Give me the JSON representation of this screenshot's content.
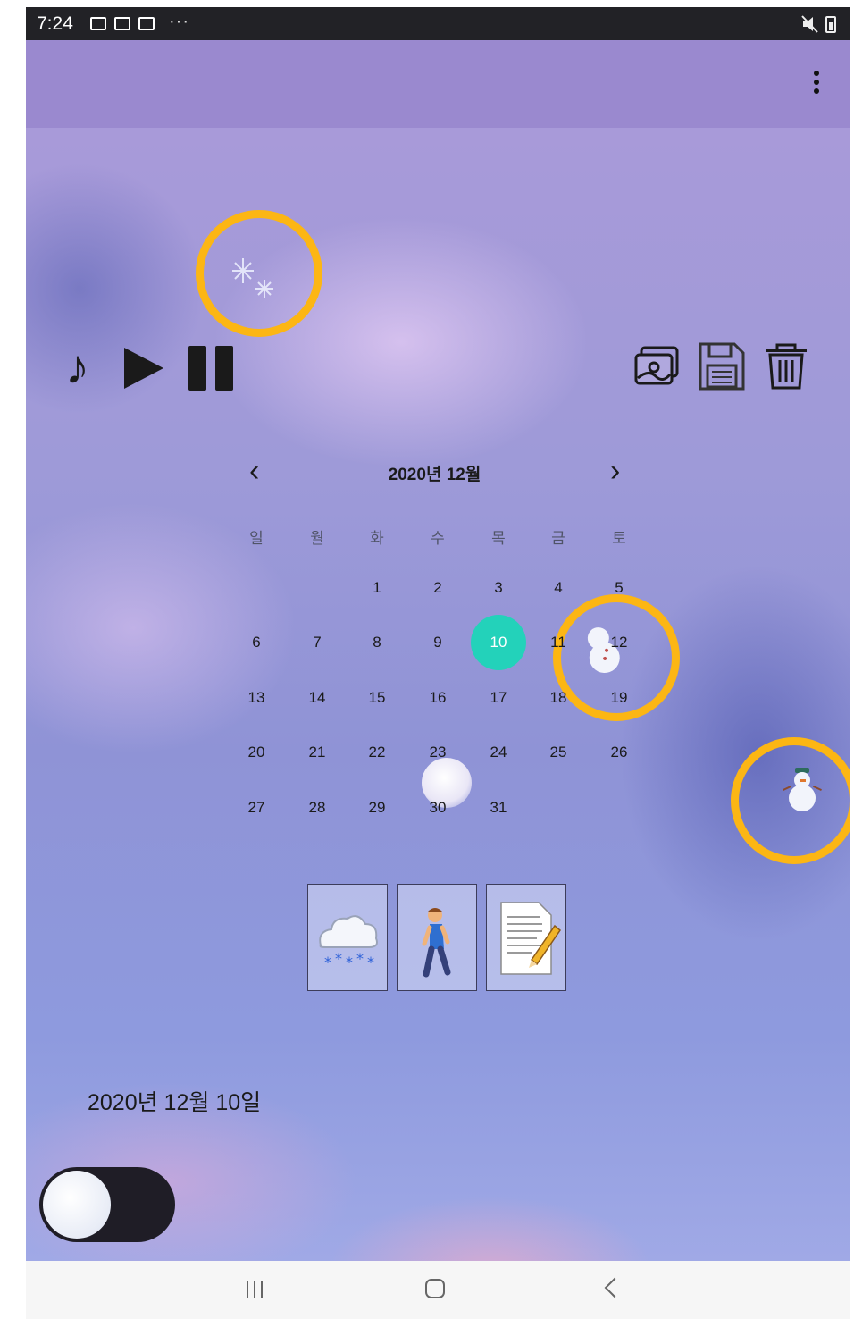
{
  "status_bar": {
    "time": "7:24",
    "notification_icons": [
      "gallery-icon",
      "contact-card-icon",
      "mail-icon"
    ],
    "more": "···",
    "right_icons": [
      "mute-icon",
      "battery-icon"
    ]
  },
  "app_bar": {
    "overflow_icon": "more-vert-icon"
  },
  "colors": {
    "app_bar": "#9a89cf",
    "selected_day": "#23d2ba",
    "highlight_circle": "#fcb614",
    "toggle_track": "#1f1d26"
  },
  "music_controls": {
    "note_icon": "music-note-icon",
    "play_icon": "play-icon",
    "pause_icon": "pause-icon",
    "note_glyph": "♪"
  },
  "toolbar": {
    "icons": [
      "gallery-icon",
      "save-icon",
      "delete-icon"
    ]
  },
  "calendar": {
    "title": "2020년 12월",
    "weekdays": [
      "일",
      "월",
      "화",
      "수",
      "목",
      "금",
      "토"
    ],
    "days": [
      "1",
      "2",
      "3",
      "4",
      "5",
      "6",
      "7",
      "8",
      "9",
      "10",
      "11",
      "12",
      "13",
      "14",
      "15",
      "16",
      "17",
      "18",
      "19",
      "20",
      "21",
      "22",
      "23",
      "24",
      "25",
      "26",
      "27",
      "28",
      "29",
      "30",
      "31"
    ],
    "selected_day": "10",
    "prev_icon": "chevron-left-icon",
    "next_icon": "chevron-right-icon"
  },
  "tiles": [
    "snow-cloud-icon",
    "person-walking-icon",
    "memo-icon"
  ],
  "selected_date_label": "2020년 12월 10일",
  "toggle": {
    "state": "on"
  },
  "nav_bar": {
    "icons": [
      "recents-icon",
      "home-icon",
      "back-icon"
    ]
  }
}
